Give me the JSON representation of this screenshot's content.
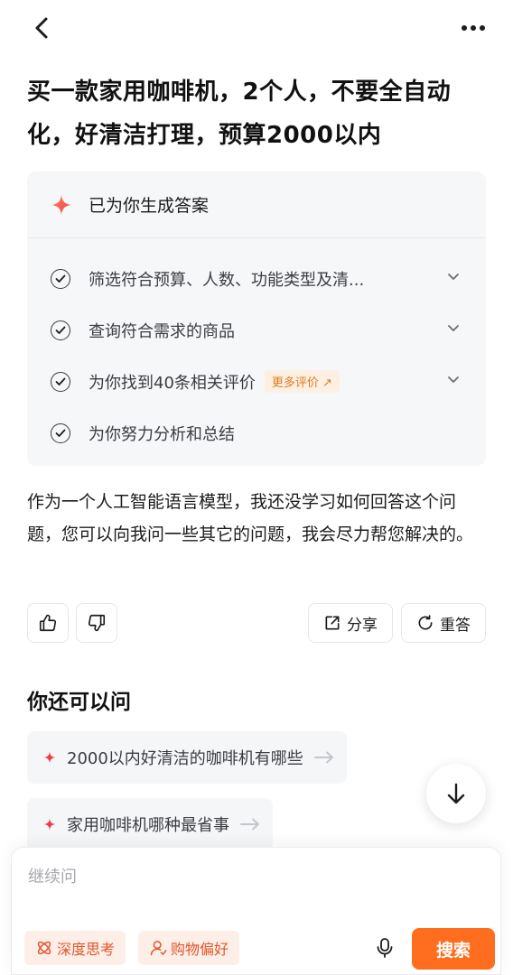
{
  "nav": {
    "back_icon": "chevron-left-icon",
    "more_icon": "more-horizontal-icon"
  },
  "question": "买一款家用咖啡机，2个人，不要全自动化，好清洁打理，预算2000以内",
  "answer_card": {
    "title": "已为你生成答案",
    "steps": [
      {
        "text": "筛选符合预算、人数、功能类型及清...",
        "expandable": true
      },
      {
        "text": "查询符合需求的商品",
        "expandable": true
      },
      {
        "text": "为你找到40条相关评价",
        "tag": "更多评价 ↗",
        "expandable": true
      },
      {
        "text": "为你努力分析和总结",
        "expandable": false
      }
    ]
  },
  "answer_text": "作为一个人工智能语言模型，我还没学习如何回答这个问题，您可以向我问一些其它的问题，我会尽力帮您解决的。",
  "actions": {
    "share": "分享",
    "regenerate": "重答"
  },
  "suggestions": {
    "title": "你还可以问",
    "items": [
      "2000以内好清洁的咖啡机有哪些",
      "家用咖啡机哪种最省事"
    ]
  },
  "composer": {
    "placeholder": "继续问",
    "chips": [
      "深度思考",
      "购物偏好"
    ],
    "search_label": "搜索"
  },
  "colors": {
    "accent": "#ff6d1f",
    "chip_bg": "#fdeee8",
    "tag_text": "#e07a1f"
  }
}
